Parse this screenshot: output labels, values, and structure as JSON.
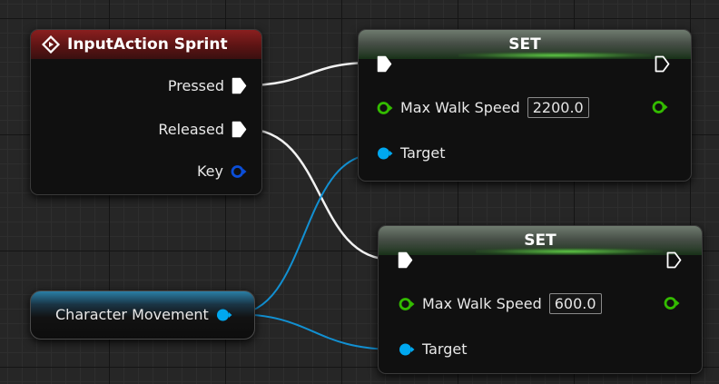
{
  "nodes": {
    "input_action": {
      "title": "InputAction Sprint",
      "pins": {
        "pressed": "Pressed",
        "released": "Released",
        "key": "Key"
      }
    },
    "set_top": {
      "title": "SET",
      "label": "Max Walk Speed",
      "value": "2200.0",
      "target": "Target"
    },
    "set_bottom": {
      "title": "SET",
      "label": "Max Walk Speed",
      "value": "600.0",
      "target": "Target"
    },
    "variable": {
      "label": "Character Movement"
    }
  },
  "colors": {
    "exec": "#ffffff",
    "float_pin": "#33bb00",
    "object_pin": "#00a8f0",
    "key_pin": "#0b4ed8",
    "event_header": "#7a1c1c",
    "set_header": "#4f9a3c"
  },
  "icons": {
    "event": "event-diamond-icon"
  }
}
